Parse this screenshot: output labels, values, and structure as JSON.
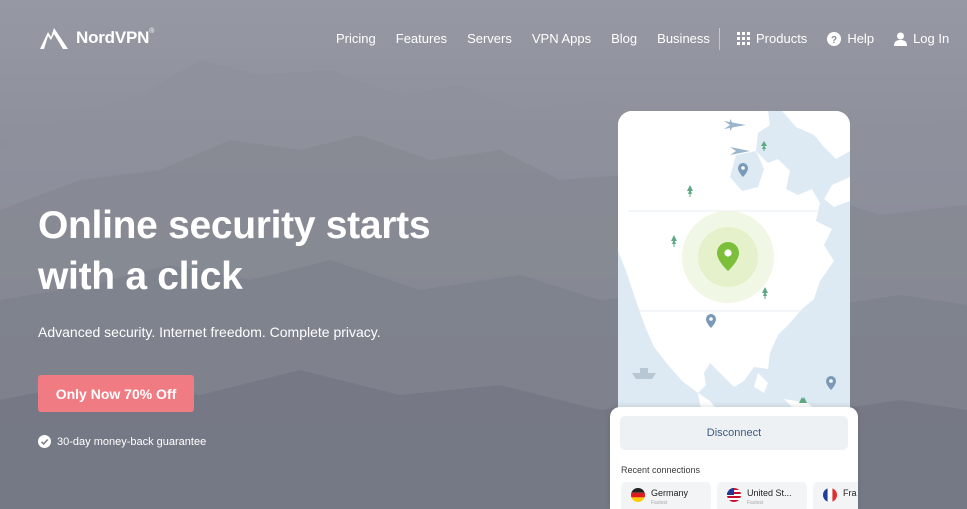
{
  "brand": {
    "name": "NordVPN"
  },
  "nav": {
    "links": [
      "Pricing",
      "Features",
      "Servers",
      "VPN Apps",
      "Blog",
      "Business"
    ],
    "products": "Products",
    "help": "Help",
    "login": "Log In"
  },
  "hero": {
    "title_line1": "Online security starts",
    "title_line2": "with a click",
    "subtitle": "Advanced security. Internet freedom. Complete privacy.",
    "cta": "Only Now 70% Off",
    "guarantee": "30-day money-back guarantee"
  },
  "app": {
    "disconnect": "Disconnect",
    "recent_label": "Recent connections",
    "recent": [
      {
        "name": "Germany",
        "sub": "Fastest"
      },
      {
        "name": "United St...",
        "sub": "Fastest"
      },
      {
        "name": "Fra",
        "sub": ""
      }
    ]
  },
  "colors": {
    "cta": "#f17b83",
    "map_land": "#ffffff",
    "map_water": "#dde9f3",
    "pin_active": "#7cbf3a",
    "pin_blue": "#7a9ab8"
  }
}
